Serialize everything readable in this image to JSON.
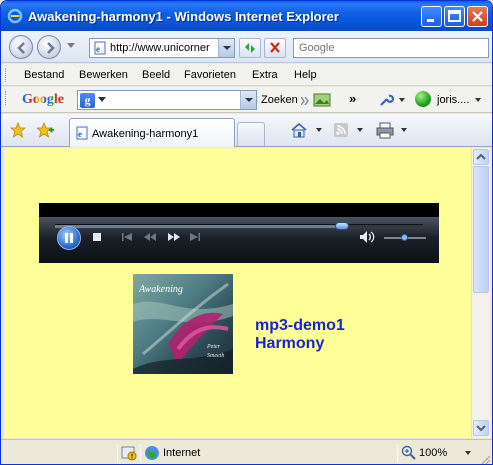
{
  "window": {
    "title": "Awakening-harmony1 - Windows Internet Explorer"
  },
  "address": {
    "url": "http://www.unicorner"
  },
  "search": {
    "placeholder": "Google"
  },
  "menu": {
    "items": [
      "Bestand",
      "Bewerken",
      "Beeld",
      "Favorieten",
      "Extra",
      "Help"
    ]
  },
  "google_toolbar": {
    "logo": "Google",
    "search_button": "Zoeken",
    "user": "joris...."
  },
  "tabs": [
    {
      "label": "Awakening-harmony1"
    }
  ],
  "player": {
    "seek_position": 0.78,
    "volume": 0.5
  },
  "album": {
    "title": "Awakening",
    "artist_line1": "Peter",
    "artist_line2": "Smeeth"
  },
  "track": {
    "title": "mp3-demo1",
    "subtitle": "Harmony"
  },
  "status": {
    "zone": "Internet",
    "zoom": "100%"
  },
  "colors": {
    "page_background": "#ffff99",
    "link_text": "#1b25c9",
    "titlebar": "#0a5df0"
  }
}
